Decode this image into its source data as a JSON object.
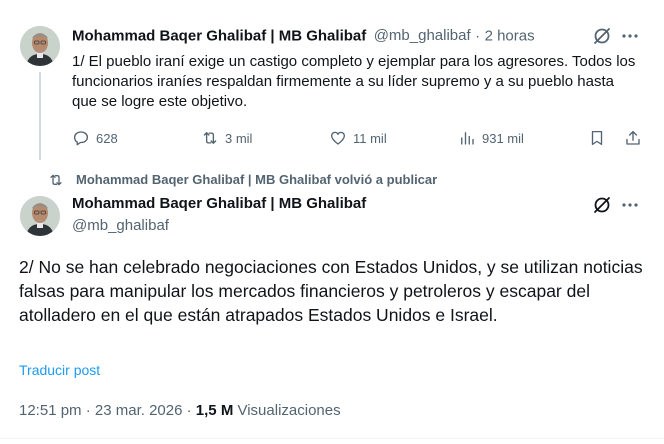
{
  "tweet1": {
    "author_name": "Mohammad Baqer Ghalibaf | MB Ghalibaf",
    "handle": "@mb_ghalibaf",
    "separator": "·",
    "time": "2 horas",
    "text": "1/ El pueblo iraní exige un castigo completo y ejemplar para los agresores. Todos los funcionarios iraníes respaldan firmemente a su líder supremo y a su pueblo hasta que se logre este objetivo.",
    "replies": "628",
    "reposts": "3 mil",
    "likes": "11 mil",
    "views": "931 mil"
  },
  "repost_context": {
    "label": "Mohammad Baqer Ghalibaf | MB Ghalibaf volvió a publicar"
  },
  "tweet2": {
    "author_name": "Mohammad Baqer Ghalibaf | MB Ghalibaf",
    "handle": "@mb_ghalibaf",
    "text": "2/ No se han celebrado negociaciones con Estados Unidos, y se utilizan noticias falsas para manipular los mercados financieros y petroleros y escapar del atolladero en el que están atrapados Estados Unidos e Israel.",
    "translate_label": "Traducir post",
    "time": "12:51 pm",
    "separator": "·",
    "date": "23 mar. 2026",
    "views_count": "1,5 M",
    "views_label": "Visualizaciones"
  },
  "colors": {
    "text_primary": "#0f1419",
    "text_secondary": "#536471",
    "link": "#1d9bf0",
    "thread_line": "#cfd9de"
  },
  "icons": [
    "grok-icon",
    "more-icon",
    "reply-icon",
    "repost-icon",
    "like-icon",
    "views-icon",
    "bookmark-icon",
    "share-icon"
  ]
}
